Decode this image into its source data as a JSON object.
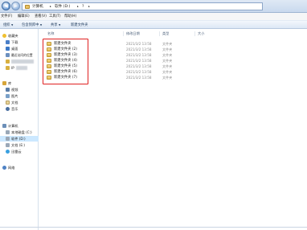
{
  "address_bar": {
    "crumbs": [
      "计算机",
      "▸",
      "软件 (D:)",
      "▸",
      "?",
      "▸"
    ]
  },
  "menu_bar": {
    "items": [
      "文件(F)",
      "编辑(E)",
      "查看(V)",
      "工具(T)",
      "帮助(H)"
    ]
  },
  "toolbar": {
    "organize": "组织",
    "include_in_library": "包含到库中",
    "share": "共享",
    "new_folder": "新建文件夹"
  },
  "nav_pane": {
    "favorites_label": "收藏夹",
    "favorites": [
      "下载",
      "桌面",
      "最近访问的位置",
      "IP"
    ],
    "libraries_label": "库",
    "libraries": [
      "视频",
      "图片",
      "文档",
      "音乐"
    ],
    "computer_label": "计算机",
    "drives": [
      "本地磁盘 (C:)",
      "软件 (D:)",
      "文档 (E:)",
      "迅雷云"
    ],
    "network_label": "网络"
  },
  "columns": {
    "name": "名称",
    "date_modified": "修改日期",
    "type": "类型",
    "size": "大小"
  },
  "files": [
    {
      "name": "新建文件夹",
      "date": "2021/3/2 13:58",
      "type": "文件夹"
    },
    {
      "name": "新建文件夹 (2)",
      "date": "2021/3/2 13:58",
      "type": "文件夹"
    },
    {
      "name": "新建文件夹 (3)",
      "date": "2021/3/2 13:58",
      "type": "文件夹"
    },
    {
      "name": "新建文件夹 (4)",
      "date": "2021/3/2 13:58",
      "type": "文件夹"
    },
    {
      "name": "新建文件夹 (5)",
      "date": "2021/3/2 13:58",
      "type": "文件夹"
    },
    {
      "name": "新建文件夹 (6)",
      "date": "2021/3/2 13:58",
      "type": "文件夹"
    },
    {
      "name": "新建文件夹 (7)",
      "date": "2021/3/2 13:58",
      "type": "文件夹"
    }
  ],
  "colors": {
    "highlight_box": "#e02020",
    "selected_drive": "#cce8ff"
  }
}
